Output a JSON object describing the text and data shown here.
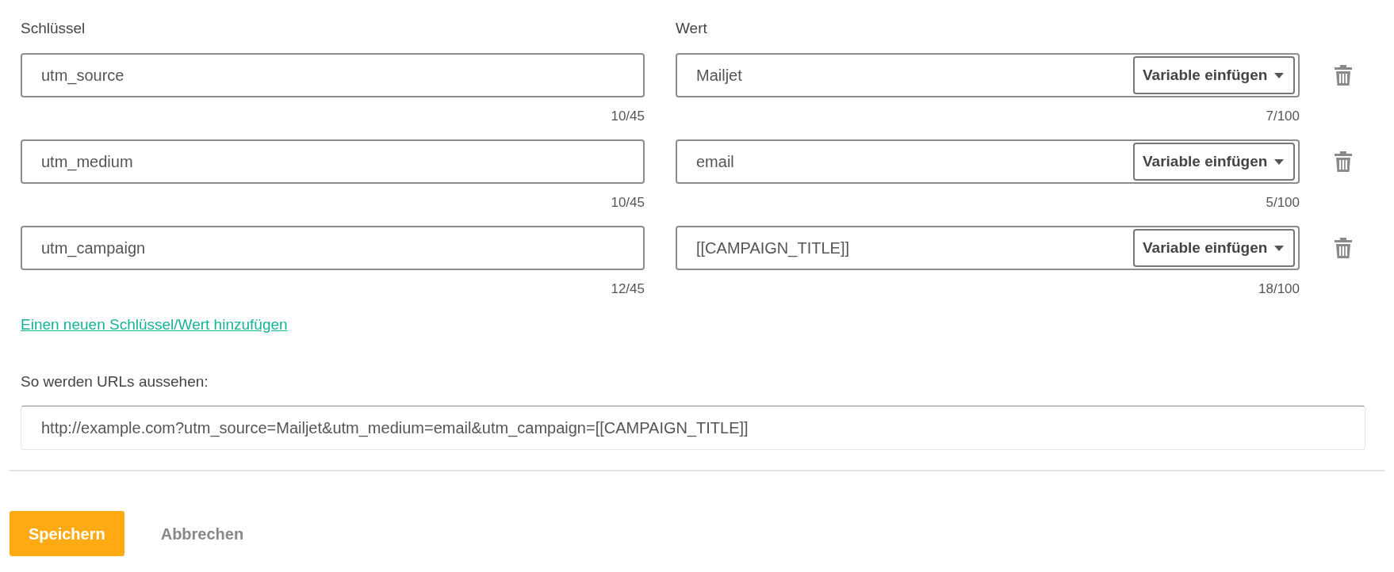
{
  "columns": {
    "key": "Schlüssel",
    "value": "Wert"
  },
  "rows": [
    {
      "key": "utm_source",
      "key_count": "10/45",
      "value": "Mailjet",
      "value_count": "7/100",
      "variable_button": "Variable einfügen"
    },
    {
      "key": "utm_medium",
      "key_count": "10/45",
      "value": "email",
      "value_count": "5/100",
      "variable_button": "Variable einfügen"
    },
    {
      "key": "utm_campaign",
      "key_count": "12/45",
      "value": "[[CAMPAIGN_TITLE]]",
      "value_count": "18/100",
      "variable_button": "Variable einfügen"
    }
  ],
  "add_link": "Einen neuen Schlüssel/Wert hinzufügen",
  "preview": {
    "label": "So werden URLs aussehen:",
    "url": "http://example.com?utm_source=Mailjet&utm_medium=email&utm_campaign=[[CAMPAIGN_TITLE]]"
  },
  "buttons": [
    {
      "label": "Speichern",
      "kind": "primary"
    },
    {
      "label": "Abbrechen",
      "kind": "secondary"
    }
  ]
}
